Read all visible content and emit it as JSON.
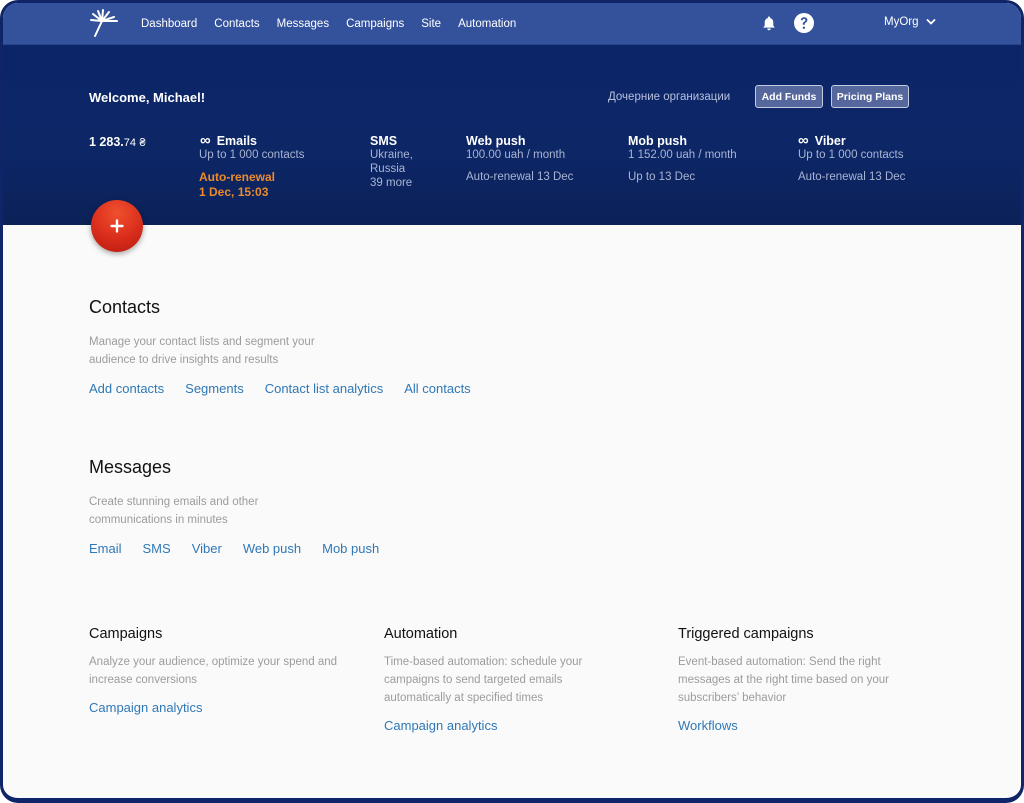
{
  "nav": {
    "items": [
      {
        "label": "Dashboard"
      },
      {
        "label": "Contacts"
      },
      {
        "label": "Messages"
      },
      {
        "label": "Campaigns"
      },
      {
        "label": "Site"
      },
      {
        "label": "Automation"
      }
    ],
    "org_label": "MyOrg",
    "icons": {
      "logo": "sunburst-logo",
      "notifications": "bell-icon",
      "help": "question-circle-icon",
      "org_menu": "chevron-down-icon"
    }
  },
  "hero": {
    "welcome": "Welcome, Michael!",
    "sub_orgs_label": "Дочерние организации",
    "add_funds_label": "Add Funds",
    "pricing_plans_label": "Pricing Plans",
    "balance": {
      "main": "1 283.",
      "cents": "74",
      "currency": "₴"
    },
    "services": {
      "emails": {
        "icon": "∞",
        "title": "Emails",
        "line1": "Up to 1 000 contacts",
        "renewal1": "Auto-renewal",
        "renewal2": "1 Dec, 15:03"
      },
      "sms": {
        "title": "SMS",
        "line1": "Ukraine,",
        "line2": "Russia",
        "line3": "39 more"
      },
      "web_push": {
        "title": "Web push",
        "line1": "100.00 uah / month",
        "line2": "Auto-renewal 13 Dec"
      },
      "mob_push": {
        "title": "Mob push",
        "line1": "1 152.00 uah / month",
        "line2": "Up to 13 Dec"
      },
      "viber": {
        "icon": "∞",
        "title": "Viber",
        "line1": "Up to 1 000 contacts",
        "line2": "Auto-renewal 13 Dec"
      }
    },
    "fab_label": "+"
  },
  "contacts": {
    "title": "Contacts",
    "description": "Manage your contact lists and segment your audience to drive insights and results",
    "links": [
      {
        "label": "Add contacts"
      },
      {
        "label": "Segments"
      },
      {
        "label": "Contact list analytics"
      },
      {
        "label": "All contacts"
      }
    ]
  },
  "messages": {
    "title": "Messages",
    "description": "Create stunning emails and other communications in minutes",
    "links": [
      {
        "label": "Email"
      },
      {
        "label": "SMS"
      },
      {
        "label": "Viber"
      },
      {
        "label": "Web push"
      },
      {
        "label": "Mob push"
      }
    ]
  },
  "columns": [
    {
      "title": "Campaigns",
      "description": "Analyze your audience, optimize your spend and increase conversions",
      "link": "Campaign analytics"
    },
    {
      "title": "Automation",
      "description": "Time-based automation: schedule your campaigns to send targeted emails automatically at specified times",
      "link": "Campaign analytics"
    },
    {
      "title": "Triggered campaigns",
      "description": "Event-based automation: Send the right messages at the right time based on your subscribers’ behavior",
      "link": "Workflows"
    }
  ],
  "colors": {
    "nav_bg": "#34529c",
    "hero_bg": "#0c2569",
    "accent_orange": "#ec8a2c",
    "link_blue": "#2f78b7",
    "fab_red": "#d92d1c"
  }
}
